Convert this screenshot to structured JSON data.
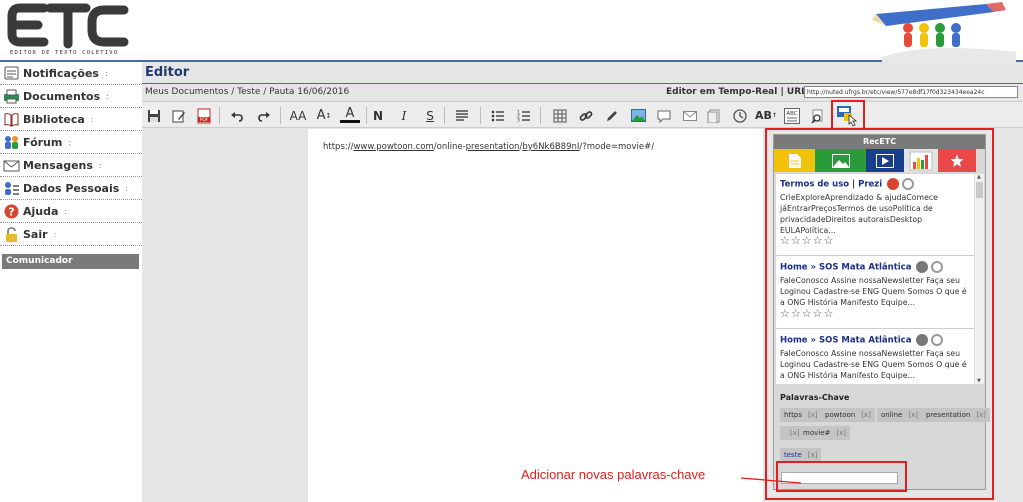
{
  "header": {
    "logo_text": "ETC",
    "logo_subtitle": "EDITOR DE TEXTO COLETIVO"
  },
  "sidebar": {
    "items": [
      {
        "label": "Notificações",
        "icon": "notification-icon"
      },
      {
        "label": "Documentos",
        "icon": "printer-icon"
      },
      {
        "label": "Biblioteca",
        "icon": "book-icon"
      },
      {
        "label": "Fórum",
        "icon": "people-icon"
      },
      {
        "label": "Mensagens",
        "icon": "envelope-icon"
      },
      {
        "label": "Dados Pessoais",
        "icon": "user-list-icon"
      },
      {
        "label": "Ajuda",
        "icon": "help-icon"
      },
      {
        "label": "Sair",
        "icon": "lock-icon"
      }
    ],
    "arrow": ":",
    "comunicador": "Comunicador"
  },
  "main": {
    "title": "Editor",
    "breadcrumb": "Meus Documentos / Teste / Pauta 16/06/2016",
    "realtime_label": "Editor em Tempo-Real | URL",
    "url": "http://nuted.ufrgs.br/etc/view/577e8df17f0d323434eea24c",
    "editor": {
      "prefix": "https://",
      "link1": "www.powtoon.com",
      "mid1": "/online-",
      "link2": "presentation",
      "mid2": "/",
      "link3": "by6Nk6B89nI",
      "suffix": "/?mode=movie#/"
    }
  },
  "toolbar": {
    "font_size_label": "AA",
    "font_label": "A",
    "bold": "N",
    "italic": "I",
    "underline": "S",
    "uppercase_label": "AB",
    "spell_label": "ABC"
  },
  "recetc": {
    "title": "RecETC",
    "tab_colors": [
      "#f2c20a",
      "#2a9b3a",
      "#1a3f8a",
      "#e3e3e3",
      "#e84848"
    ],
    "items": [
      {
        "title": "Termos de uso | Prezi",
        "description": "CrieExploreAprendizado & ajudaComece jáEntrarPreçosTermos de usoPolítica de privacidadeDireitos autoraisDesktop EULAPolítica...",
        "rating": "☆☆☆☆☆",
        "icon": "heart-icon"
      },
      {
        "title": "Home » SOS Mata Atlântica",
        "description": "FaleConosco Assine nossaNewsletter Faça seu Loginou Cadastre-se ENG Quem Somos O que é a ONG História Manifesto Equipe...",
        "rating": "☆☆☆☆☆",
        "icon": "circle-icon"
      },
      {
        "title": "Home » SOS Mata Atlântica",
        "description": "FaleConosco Assine nossaNewsletter Faça seu Loginou Cadastre-se ENG Quem Somos O que é a ONG História Manifesto Equipe...",
        "rating": "☆☆☆☆☆",
        "icon": "circle-icon"
      }
    ],
    "keywords_title": "Palavras-Chave",
    "keywords": [
      "https",
      "powtoon",
      "online",
      "presentation",
      "",
      "movie#",
      "teste"
    ],
    "remove_label": "[x]"
  },
  "annotation": "Adicionar novas palavras-chave"
}
